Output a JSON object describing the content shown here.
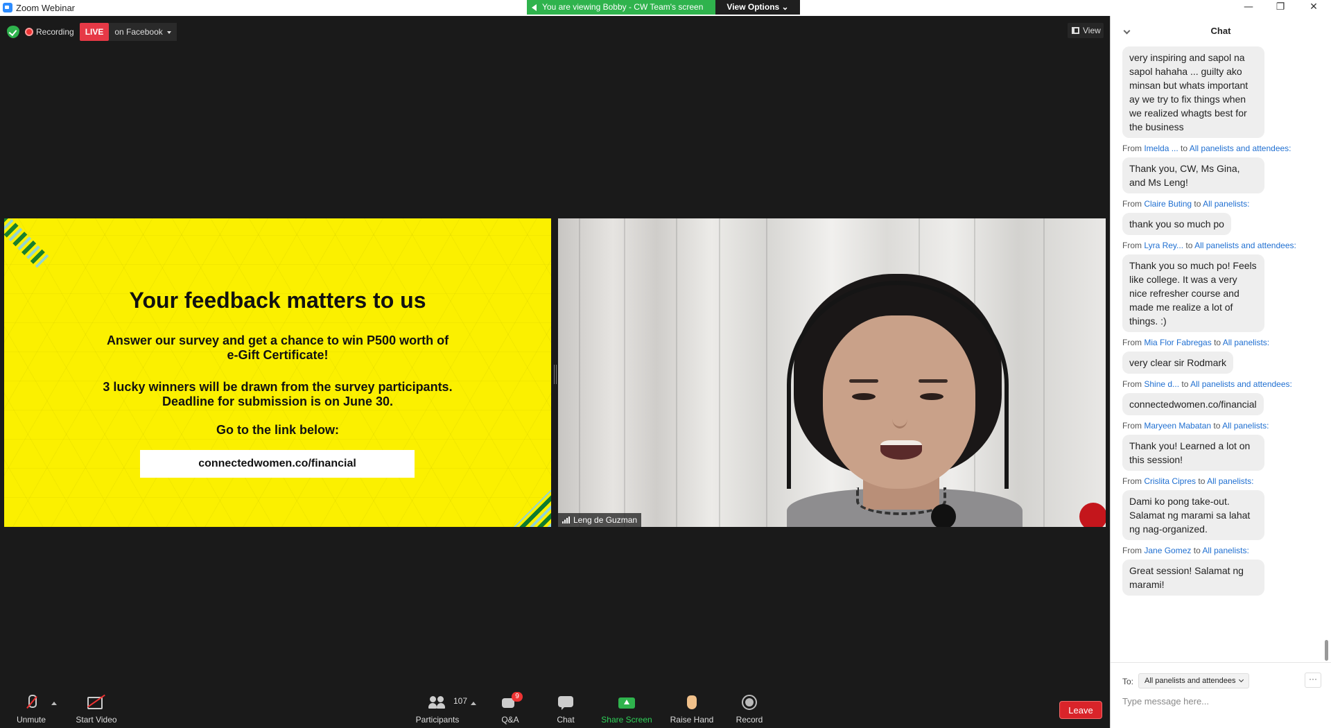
{
  "window": {
    "title": "Zoom Webinar",
    "minimize_icon": "—",
    "restore_icon": "❐",
    "close_icon": "✕"
  },
  "share_banner": {
    "message": "You are viewing Bobby - CW Team's screen",
    "view_options": "View Options ⌄"
  },
  "top_controls": {
    "recording_label": "Recording",
    "live_label": "LIVE",
    "stream_target": "on Facebook",
    "view_label": "View"
  },
  "slide": {
    "title": "Your feedback matters to us",
    "line1": "Answer our survey and get a chance to win  P500 worth of",
    "line2": "e-Gift Certificate!",
    "line3": "3 lucky winners will be drawn from the survey participants.",
    "line4": "Deadline for submission is on June 30.",
    "line5": "Go to the link below:",
    "link": "connectedwomen.co/financial"
  },
  "video": {
    "participant_name": "Leng de Guzman"
  },
  "toolbar": {
    "unmute": "Unmute",
    "start_video": "Start Video",
    "participants": "Participants",
    "participant_count": "107",
    "qa": "Q&A",
    "qa_badge": "9",
    "chat": "Chat",
    "share_screen": "Share Screen",
    "raise_hand": "Raise Hand",
    "record": "Record",
    "leave": "Leave"
  },
  "chat": {
    "title": "Chat",
    "to_label": "To:",
    "recipient": "All panelists and attendees",
    "more": "···",
    "placeholder": "Type message here...",
    "messages": [
      {
        "from": "",
        "connector": "",
        "to": "",
        "text": "very inspiring and sapol na sapol hahaha ... guilty ako minsan but whats important ay we try to fix things when we realized whagts best for the business"
      },
      {
        "from": "Imelda ...",
        "connector": "to",
        "to": "All panelists and attendees:",
        "text": "Thank you, CW, Ms Gina, and Ms Leng!"
      },
      {
        "from": "Claire Buting",
        "connector": "to",
        "to": "All panelists:",
        "text": "thank you so much po"
      },
      {
        "from": "Lyra Rey...",
        "connector": "to",
        "to": "All panelists and attendees:",
        "text": "Thank you so much po! Feels like college. It was a very nice refresher course and made me realize a lot of things. :)"
      },
      {
        "from": "Mia Flor Fabregas",
        "connector": "to",
        "to": "All panelists:",
        "text": "very clear sir Rodmark"
      },
      {
        "from": "Shine d...",
        "connector": "to",
        "to": "All panelists and attendees:",
        "text": "connectedwomen.co/financial"
      },
      {
        "from": "Maryeen Mabatan",
        "connector": "to",
        "to": "All panelists:",
        "text": "Thank you! Learned a lot on this session!"
      },
      {
        "from": "Crislita Cipres",
        "connector": "to",
        "to": "All panelists:",
        "text": "Dami ko pong take-out. Salamat ng marami sa lahat ng nag-organized."
      },
      {
        "from": "Jane Gomez",
        "connector": "to",
        "to": "All panelists:",
        "text": "Great session! Salamat ng marami!"
      }
    ]
  }
}
